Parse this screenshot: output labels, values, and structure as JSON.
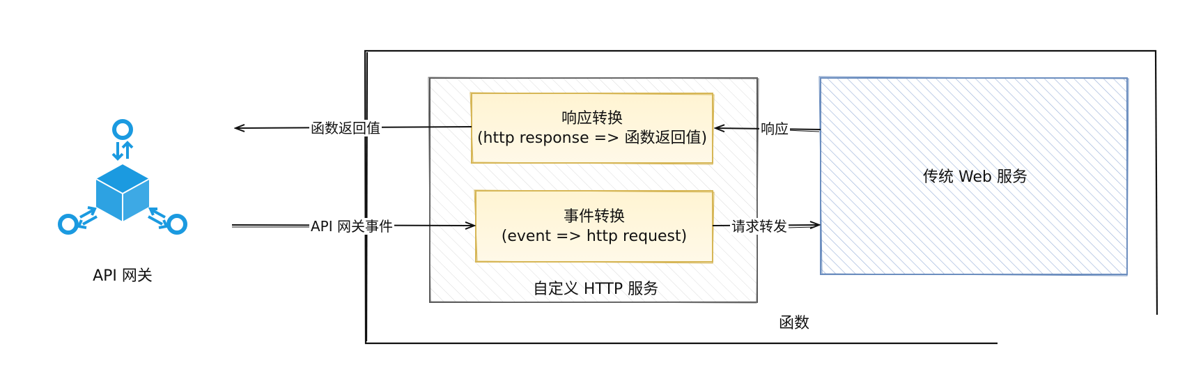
{
  "gateway": {
    "icon": "api-gateway-icon",
    "label": "API 网关",
    "color": "#1B9AE0"
  },
  "function_container": {
    "label": "函数"
  },
  "custom_http_service": {
    "label": "自定义 HTTP 服务"
  },
  "response_transform": {
    "title": "响应转换",
    "subtitle": "(http response => 函数返回值)"
  },
  "event_transform": {
    "title": "事件转换",
    "subtitle": "(event => http request)"
  },
  "web_service": {
    "label": "传统 Web 服务",
    "color": "#6C8EBF"
  },
  "edges": {
    "return_value": "函数返回值",
    "gateway_event": "API 网关事件",
    "forward_request": "请求转发",
    "response": "响应"
  },
  "colors": {
    "transform_fill": "#FFF6D6",
    "transform_stroke": "#D6B656",
    "hatch": "#D0D0D0"
  }
}
